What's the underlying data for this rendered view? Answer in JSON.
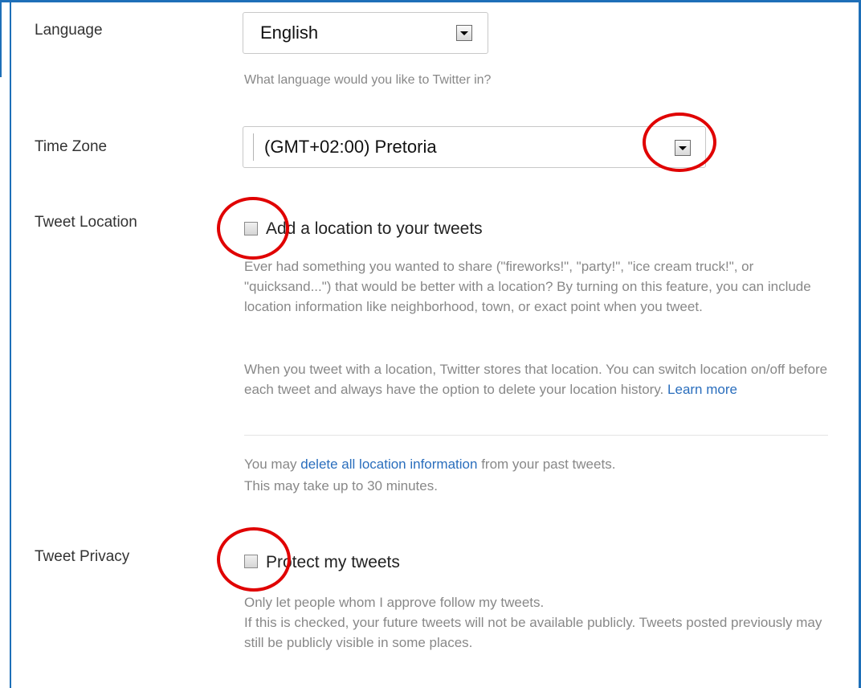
{
  "language": {
    "label": "Language",
    "selected": "English",
    "hint": "What language would you like to Twitter in?"
  },
  "time_zone": {
    "label": "Time Zone",
    "selected": "(GMT+02:00) Pretoria"
  },
  "tweet_location": {
    "label": "Tweet Location",
    "checkbox_label": "Add a location to your tweets",
    "description": "Ever had something you wanted to share (\"fireworks!\", \"party!\", \"ice cream truck!\", or \"quicksand...\") that would be better with a location? By turning on this feature, you can include location information like neighborhood, town, or exact point when you tweet.",
    "storage_text": "When you tweet with a location, Twitter stores that location. You can switch location on/off before each tweet and always have the option to delete your location history.",
    "learn_more": "Learn more",
    "delete_prefix": "You may",
    "delete_link": "delete all location information",
    "delete_suffix": "from your past tweets.",
    "delete_note": "This may take up to 30 minutes."
  },
  "tweet_privacy": {
    "label": "Tweet Privacy",
    "checkbox_label": "Protect my tweets",
    "description_1": "Only let people whom I approve follow my tweets.",
    "description_2": "If this is checked, your future tweets will not be available publicly. Tweets posted previously may still be publicly visible in some places."
  },
  "colors": {
    "accent": "#1e6fb8",
    "link": "#2a6ebd",
    "annotation": "#e00000"
  },
  "icons": [
    "chevron-down-icon",
    "annotation-circle"
  ]
}
